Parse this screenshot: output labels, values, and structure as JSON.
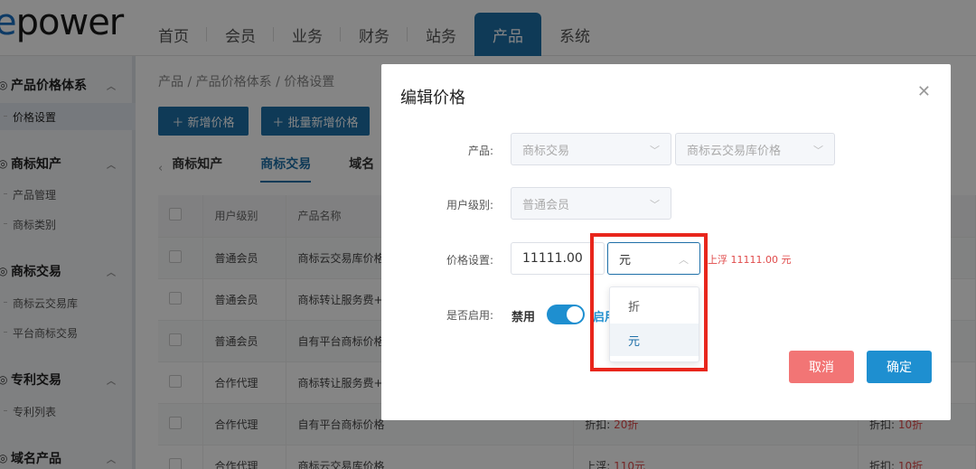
{
  "app": {
    "logo_dot": "e",
    "logo_text": "power"
  },
  "topnav": [
    "首页",
    "会员",
    "业务",
    "财务",
    "站务",
    "产品",
    "系统"
  ],
  "sidebar": {
    "groups": [
      {
        "label": "产品价格体系",
        "items": [
          "价格设置"
        ]
      },
      {
        "label": "商标知产",
        "items": [
          "产品管理",
          "商标类别"
        ]
      },
      {
        "label": "商标交易",
        "items": [
          "商标云交易库",
          "平台商标交易"
        ]
      },
      {
        "label": "专利交易",
        "items": [
          "专利列表"
        ]
      },
      {
        "label": "域名产品",
        "items": []
      }
    ]
  },
  "breadcrumb": "产品  /  产品价格体系  /  价格设置",
  "actions": {
    "add": "＋ 新增价格",
    "batch_add": "＋ 批量新增价格"
  },
  "tabs": [
    "商标知产",
    "商标交易",
    "域名"
  ],
  "table": {
    "headers": [
      "用户级别",
      "产品名称"
    ],
    "rows": [
      {
        "level": "普通会员",
        "name": "商标云交易库价格",
        "p1": "",
        "p2": ""
      },
      {
        "level": "普通会员",
        "name": "商标转让服务费+",
        "p1": "",
        "p2": ""
      },
      {
        "level": "普通会员",
        "name": "自有平台商标价格",
        "p1": "",
        "p2": ""
      },
      {
        "level": "合作代理",
        "name": "商标转让服务费+",
        "p1": "",
        "p2": ""
      },
      {
        "level": "合作代理",
        "name": "自有平台商标价格",
        "p1a": "折扣:",
        "p1b": "20折",
        "p2a": "折扣:",
        "p2b": "10折"
      },
      {
        "level": "合作代理",
        "name": "商标云交易库价格",
        "p1a": "上浮:",
        "p1b": "110元",
        "p2a": "折扣:",
        "p2b": "10折"
      }
    ]
  },
  "modal": {
    "title": "编辑价格",
    "product_label": "产品:",
    "product_value1": "商标交易",
    "product_value2": "商标云交易库价格",
    "level_label": "用户级别:",
    "level_value": "普通会员",
    "price_label": "价格设置:",
    "price_value": "11111.00",
    "unit_value": "元",
    "price_hint": "上浮 11111.00 元",
    "enable_label": "是否启用:",
    "disable_text": "禁用",
    "enable_text": "启用",
    "unit_options": [
      "折",
      "元"
    ],
    "cancel": "取消",
    "confirm": "确定"
  }
}
